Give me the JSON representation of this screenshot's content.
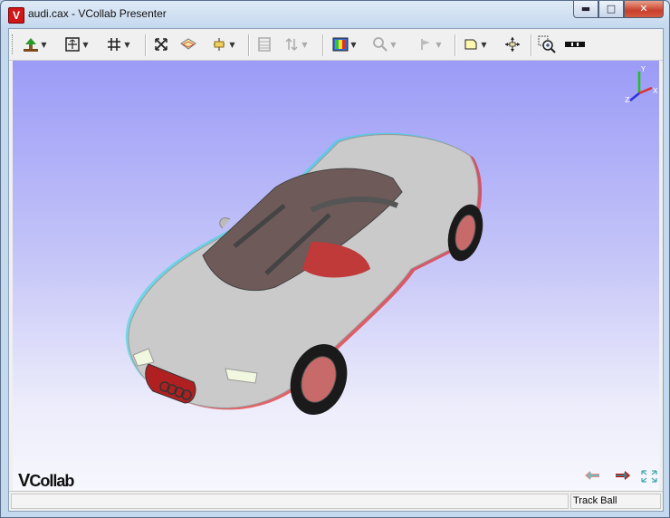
{
  "window": {
    "title": "audi.cax - VCollab Presenter",
    "app_icon_letter": "V"
  },
  "window_controls": {
    "minimize": "▬",
    "maximize": "□",
    "close": "✕"
  },
  "toolbar": {
    "items": [
      {
        "icon": "tree-icon",
        "glyph": "🌳",
        "dropdown": true,
        "enabled": true
      },
      {
        "icon": "fit-view-icon",
        "glyph": "⛶",
        "dropdown": true,
        "enabled": true
      },
      {
        "icon": "grid-icon",
        "glyph": "#",
        "dropdown": true,
        "enabled": true
      },
      {
        "icon": "explode-icon",
        "glyph": "✕",
        "dropdown": false,
        "enabled": true
      },
      {
        "icon": "box-view-icon",
        "glyph": "◈",
        "dropdown": false,
        "enabled": true
      },
      {
        "icon": "section-icon",
        "glyph": "✥",
        "dropdown": true,
        "enabled": true
      },
      {
        "icon": "animation-icon",
        "glyph": "▦",
        "dropdown": false,
        "enabled": false
      },
      {
        "icon": "sort-icon",
        "glyph": "⇅",
        "dropdown": true,
        "enabled": false
      },
      {
        "icon": "contour-icon",
        "glyph": "▣",
        "dropdown": true,
        "enabled": true
      },
      {
        "icon": "probe-icon",
        "glyph": "🔍",
        "dropdown": true,
        "enabled": false
      },
      {
        "icon": "flag-icon",
        "glyph": "⚑",
        "dropdown": true,
        "enabled": false
      },
      {
        "icon": "note-icon",
        "glyph": "▢",
        "dropdown": true,
        "enabled": true
      },
      {
        "icon": "pan-icon",
        "glyph": "✥",
        "dropdown": false,
        "enabled": true
      },
      {
        "icon": "zoom-in-icon",
        "glyph": "⊕",
        "dropdown": false,
        "enabled": true
      },
      {
        "icon": "scale-bar-icon",
        "glyph": "▬▬",
        "dropdown": false,
        "enabled": true
      }
    ]
  },
  "triad": {
    "x": "X",
    "y": "Y",
    "z": "Z"
  },
  "navigation": {
    "previous_icon": "previous-arrow-icon",
    "next_icon": "next-arrow-icon",
    "fullscreen_icon": "fullscreen-icon"
  },
  "logo": {
    "text_v": "V",
    "text_rest": "Collab"
  },
  "status": {
    "main": "",
    "mode": "Track Ball"
  },
  "colors": {
    "viewport_top": "#9b9bf7",
    "viewport_bottom": "#f7f7fe",
    "car_body": "#c9c9c9",
    "accent_red": "#d01818"
  }
}
